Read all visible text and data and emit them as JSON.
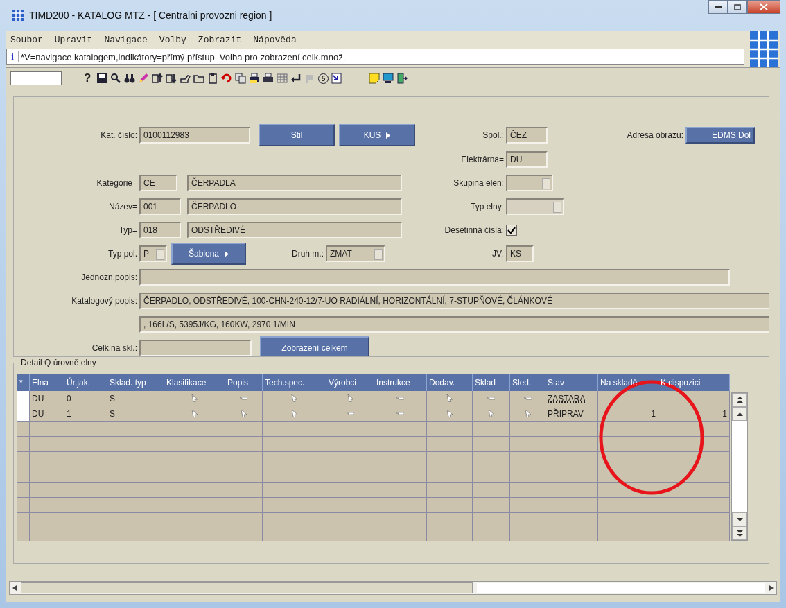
{
  "window": {
    "title": "TIMD200 - KATALOG MTZ - [ Centralni provozni region ]"
  },
  "menu": [
    "Soubor",
    "Upravit",
    "Navigace",
    "Volby",
    "Zobrazit",
    "Nápověda"
  ],
  "info_line": {
    "icon": "i",
    "text": "*V=navigace katalogem,indikátory=přímý přístup. Volba pro zobrazení celk.množ."
  },
  "toolbar": {
    "help": "?",
    "number_icon": "5"
  },
  "form": {
    "kat_cislo": {
      "label": "Kat. číslo:",
      "value": "0100112983"
    },
    "buttons": [
      {
        "label": "Stil",
        "arrow": false
      },
      {
        "label": "KUS",
        "arrow": true
      }
    ],
    "spol": {
      "label": "Spol.:",
      "value": "ČEZ"
    },
    "adresa_obrazu": {
      "label": "Adresa obrazu:",
      "button": "EDMS Dol"
    },
    "elektrarna": {
      "label": "Elektrárna=",
      "value": "DU"
    },
    "kategorie": {
      "label": "Kategorie=",
      "code": "CE",
      "name": "ČERPADLA"
    },
    "skupina_elen": {
      "label": "Skupina elen:",
      "disabled": false
    },
    "nazev": {
      "label": "Název=",
      "code": "001",
      "name": "ČERPADLO"
    },
    "typ_elny": {
      "label": "Typ elny:",
      "disabled": true
    },
    "typ": {
      "label": "Typ=",
      "code": "018",
      "name": "ODSTŘEDIVÉ"
    },
    "desetinna_cisla": {
      "label": "Desetinná čísla:",
      "checked": true
    },
    "typ_pol": {
      "label": "Typ pol.",
      "value": "P"
    },
    "sablona": {
      "label": "Šablona",
      "arrow": true
    },
    "druh_m": {
      "label": "Druh m.:",
      "value": "ZMAT"
    },
    "jv": {
      "label": "JV:",
      "value": "KS"
    },
    "jednozn_popis": {
      "label": "Jednozn.popis:"
    },
    "katalogovy_popis": {
      "label": "Katalogový popis:",
      "lines": [
        "ČERPADLO, ODSTŘEDIVÉ, 100-CHN-240-12/7-UO RADIÁLNÍ, HORIZONTÁLNÍ, 7-STUPŇOVÉ, ČLÁNKOVÉ",
        ", 166L/S, 5395J/KG, 160KW, 2970 1/MIN"
      ]
    },
    "celk_na_skl": {
      "label": "Celk.na skl.:",
      "button": "Zobrazení celkem"
    }
  },
  "detail": {
    "title": "Detail Q úrovně elny",
    "columns": [
      "*",
      "Elna",
      "Úr.jak.",
      "Sklad. typ",
      "Klasifikace",
      "Popis",
      "Tech.spec.",
      "Výrobci",
      "Instrukce",
      "Dodav.",
      "Sklad",
      "Sled.",
      "Stav",
      "Na skladě",
      "K dispozici"
    ],
    "rows": [
      {
        "elna": "DU",
        "ur_jak": "0",
        "sklad_typ": "S",
        "links": [
          true,
          false,
          true,
          true,
          false,
          true,
          false,
          false
        ],
        "stav": "ZASTARA",
        "focused": true
      },
      {
        "elna": "DU",
        "ur_jak": "1",
        "sklad_typ": "S",
        "links": [
          true,
          true,
          true,
          false,
          false,
          true,
          true,
          true
        ],
        "stav": "PŘIPRAV",
        "focused": false,
        "na_sklade": "1",
        "k_dispozici": "1"
      }
    ]
  }
}
